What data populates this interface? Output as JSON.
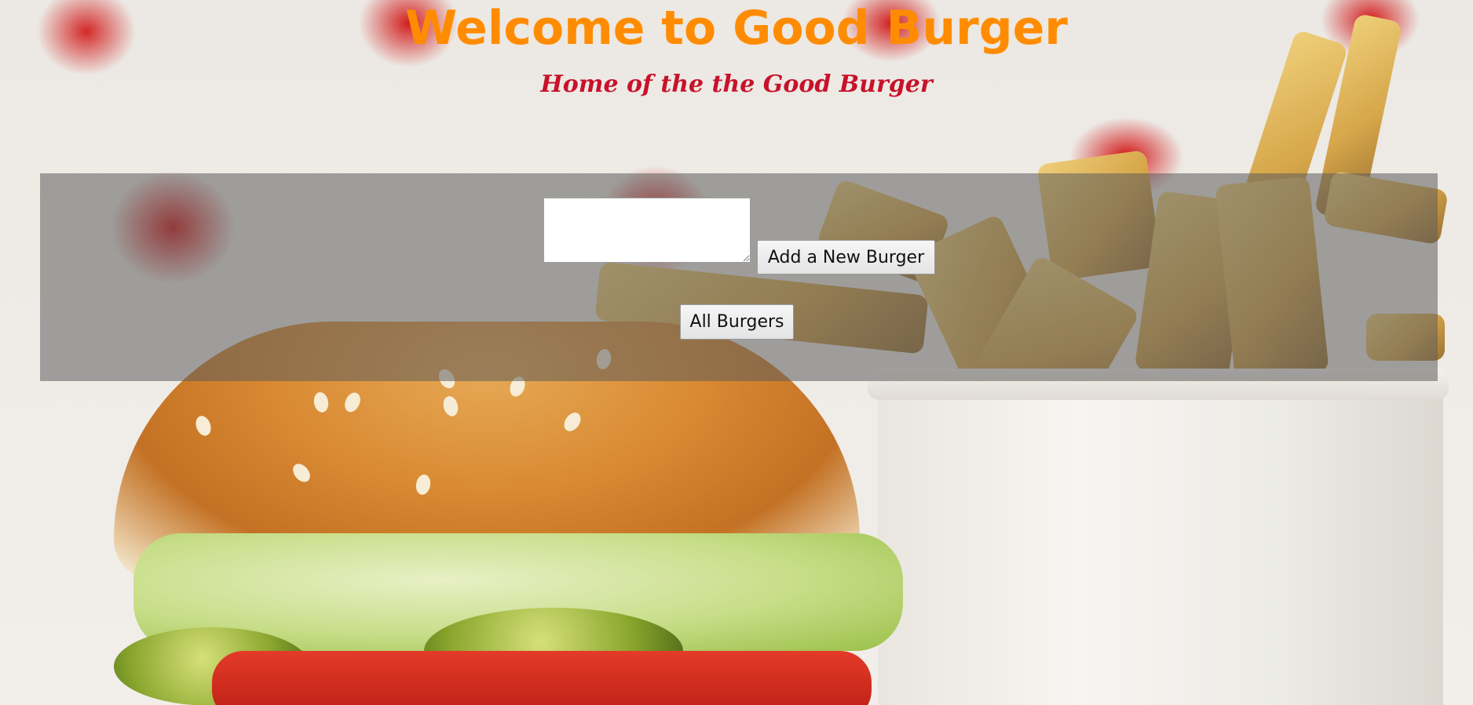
{
  "header": {
    "title": "Welcome to Good Burger",
    "subtitle": "Home of the the Good Burger"
  },
  "form": {
    "burger_input_value": "",
    "add_button_label": "Add a New Burger",
    "all_button_label": "All Burgers"
  },
  "colors": {
    "title": "#ff8c00",
    "subtitle": "#c8122a",
    "panel_overlay": "rgba(92,92,92,0.55)"
  }
}
